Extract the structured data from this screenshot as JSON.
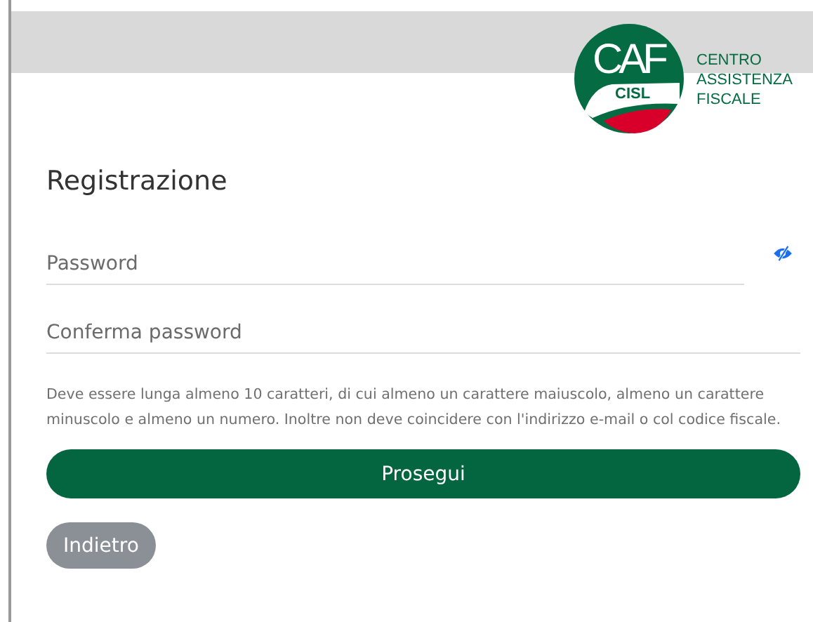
{
  "header": {
    "logo": {
      "mark": "CAF",
      "sub_mark": "CISL",
      "lines": [
        "CENTRO",
        "ASSISTENZA",
        "FISCALE"
      ]
    }
  },
  "form": {
    "title": "Registrazione",
    "fields": [
      {
        "kind": "password",
        "placeholder": "Password"
      },
      {
        "kind": "plain",
        "placeholder": "Conferma password"
      }
    ],
    "hint": "Deve essere lunga almeno 10 caratteri, di cui almeno un carattere maiuscolo, almeno un carattere minuscolo e almeno un numero. Inoltre non deve coincidere con l'indirizzo e-mail o col codice fiscale.",
    "buttons": [
      {
        "kind": "primary",
        "label": "Prosegui"
      },
      {
        "kind": "secondary",
        "label": "Indietro"
      }
    ]
  }
}
